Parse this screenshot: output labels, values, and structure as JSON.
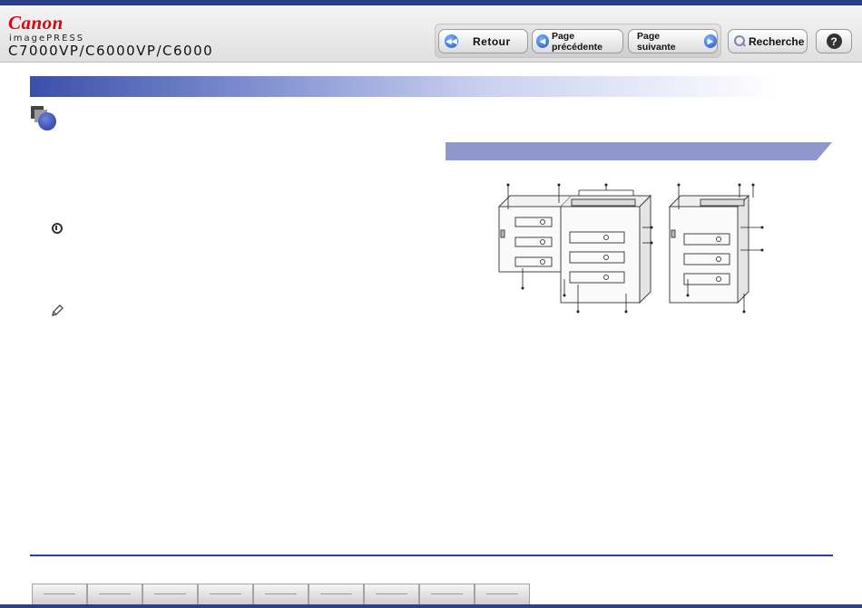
{
  "header": {
    "brand": "Canon",
    "product": "imagePRESS",
    "model": "C7000VP/C6000VP/C6000"
  },
  "toolbar": {
    "retour_label": "Retour",
    "prev_label": "Page précédente",
    "next_label": "Page suivante",
    "search_label": "Recherche",
    "help_label": "?"
  },
  "footer": {
    "tabs": [
      "",
      "",
      "",
      "",
      "",
      "",
      "",
      "",
      "",
      ""
    ]
  },
  "colors": {
    "accent": "#2c3f8f",
    "brand": "#d10a11",
    "figure_header": "#8f97cd"
  },
  "icons": [
    "rewind-icon",
    "arrow-left-icon",
    "arrow-right-icon",
    "search-icon",
    "help-icon",
    "important-icon",
    "note-pencil-icon"
  ]
}
